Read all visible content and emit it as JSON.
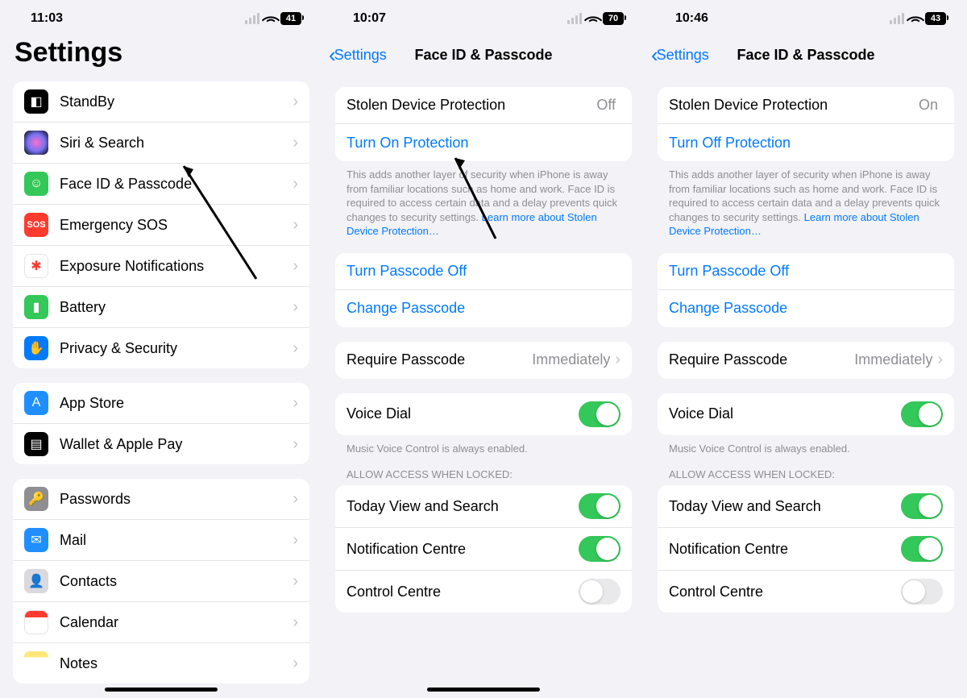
{
  "panel1": {
    "time": "11:03",
    "battery": "41",
    "title": "Settings",
    "group1": [
      {
        "label": "StandBy",
        "icon": "ic-standby",
        "glyph": "◧",
        "name": "standby"
      },
      {
        "label": "Siri & Search",
        "icon": "ic-siri",
        "glyph": "",
        "name": "siri-search"
      },
      {
        "label": "Face ID & Passcode",
        "icon": "ic-faceid",
        "glyph": "☺",
        "name": "faceid-passcode"
      },
      {
        "label": "Emergency SOS",
        "icon": "ic-sos",
        "glyph": "SOS",
        "name": "emergency-sos"
      },
      {
        "label": "Exposure Notifications",
        "icon": "ic-expo",
        "glyph": "✱",
        "name": "exposure-notifications"
      },
      {
        "label": "Battery",
        "icon": "ic-batt",
        "glyph": "▮",
        "name": "battery"
      },
      {
        "label": "Privacy & Security",
        "icon": "ic-priv",
        "glyph": "✋",
        "name": "privacy-security"
      }
    ],
    "group2": [
      {
        "label": "App Store",
        "icon": "ic-appst",
        "glyph": "A",
        "name": "app-store"
      },
      {
        "label": "Wallet & Apple Pay",
        "icon": "ic-wallet",
        "glyph": "▤",
        "name": "wallet-apple-pay"
      }
    ],
    "group3": [
      {
        "label": "Passwords",
        "icon": "ic-pass",
        "glyph": "🔑",
        "name": "passwords"
      },
      {
        "label": "Mail",
        "icon": "ic-mail",
        "glyph": "✉",
        "name": "mail"
      },
      {
        "label": "Contacts",
        "icon": "ic-cont",
        "glyph": "👤",
        "name": "contacts"
      },
      {
        "label": "Calendar",
        "icon": "ic-cal",
        "glyph": "",
        "name": "calendar"
      },
      {
        "label": "Notes",
        "icon": "ic-notes",
        "glyph": "",
        "name": "notes"
      }
    ]
  },
  "panel2": {
    "time": "10:07",
    "battery": "70",
    "back": "Settings",
    "title": "Face ID & Passcode",
    "sdp_label": "Stolen Device Protection",
    "sdp_value": "Off",
    "sdp_action": "Turn On Protection",
    "sdp_footer": "This adds another layer of security when iPhone is away from familiar locations such as home and work. Face ID is required to access certain data and a delay prevents quick changes to security settings. ",
    "sdp_link": "Learn more about Stolen Device Protection…",
    "passcode_off": "Turn Passcode Off",
    "change_passcode": "Change Passcode",
    "require_label": "Require Passcode",
    "require_value": "Immediately",
    "voice_dial": "Voice Dial",
    "voice_footer": "Music Voice Control is always enabled.",
    "allow_header": "ALLOW ACCESS WHEN LOCKED:",
    "today": "Today View and Search",
    "notif": "Notification Centre",
    "control": "Control Centre"
  },
  "panel3": {
    "time": "10:46",
    "battery": "43",
    "back": "Settings",
    "title": "Face ID & Passcode",
    "sdp_label": "Stolen Device Protection",
    "sdp_value": "On",
    "sdp_action": "Turn Off Protection",
    "sdp_footer": "This adds another layer of security when iPhone is away from familiar locations such as home and work. Face ID is required to access certain data and a delay prevents quick changes to security settings. ",
    "sdp_link": "Learn more about Stolen Device Protection…",
    "passcode_off": "Turn Passcode Off",
    "change_passcode": "Change Passcode",
    "require_label": "Require Passcode",
    "require_value": "Immediately",
    "voice_dial": "Voice Dial",
    "voice_footer": "Music Voice Control is always enabled.",
    "allow_header": "ALLOW ACCESS WHEN LOCKED:",
    "today": "Today View and Search",
    "notif": "Notification Centre",
    "control": "Control Centre"
  }
}
